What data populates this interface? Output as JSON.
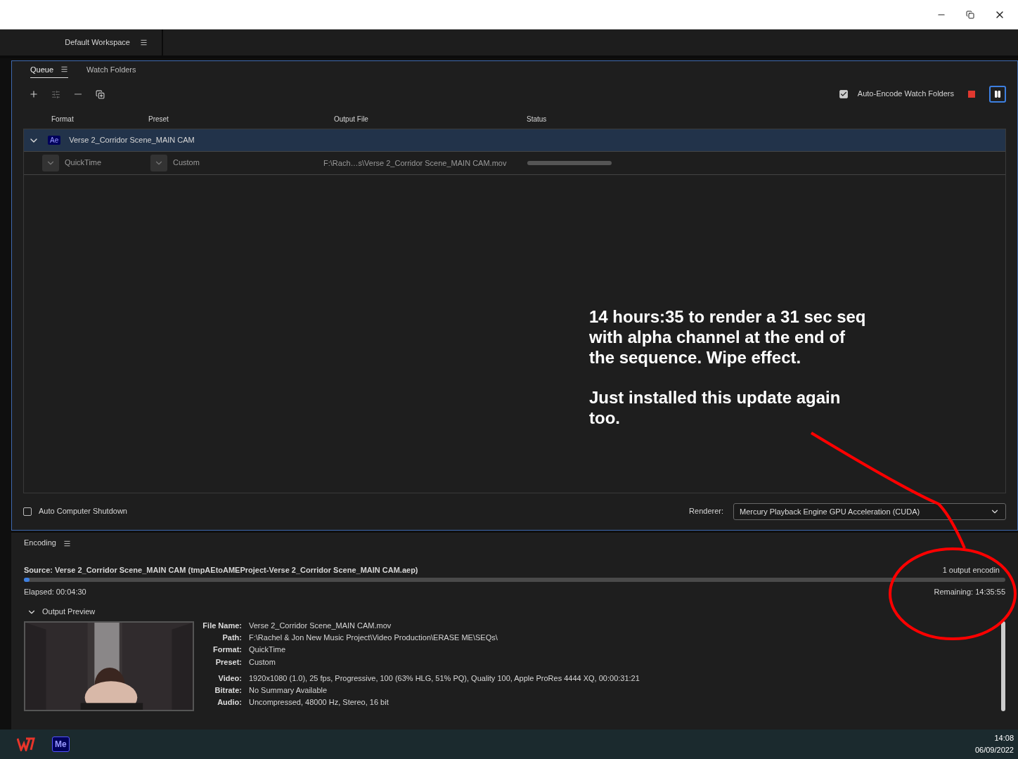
{
  "workspace": {
    "label": "Default Workspace"
  },
  "queue_panel": {
    "tabs": [
      {
        "label": "Queue",
        "selected": true
      },
      {
        "label": "Watch Folders",
        "selected": false
      }
    ],
    "auto_encode": {
      "label": "Auto-Encode Watch Folders",
      "checked": true
    },
    "columns": [
      "Format",
      "Preset",
      "Output File",
      "Status"
    ],
    "source": {
      "badge": "Ae",
      "name": "Verse 2_Corridor Scene_MAIN CAM",
      "expanded": true,
      "selected": true
    },
    "outputs": [
      {
        "format": "QuickTime",
        "preset": "Custom",
        "output_file": "F:\\Rach…s\\Verse 2_Corridor Scene_MAIN CAM.mov"
      }
    ],
    "auto_shutdown": {
      "label": "Auto Computer Shutdown",
      "checked": false
    },
    "renderer": {
      "label": "Renderer:",
      "value": "Mercury Playback Engine GPU Acceleration (CUDA)"
    }
  },
  "annotation": {
    "paragraphs": [
      "14 hours:35 to render a 31 sec seq with alpha channel at the end of the sequence. Wipe effect.",
      "Just installed this update again too."
    ]
  },
  "encoding_panel": {
    "title": "Encoding",
    "source": "Source: Verse 2_Corridor Scene_MAIN CAM (tmpAEtoAMEProject-Verse 2_Corridor Scene_MAIN CAM.aep)",
    "output_count": "1 output encodin",
    "level": 0.006,
    "elapsed": "Elapsed: 00:04:30",
    "remaining": "Remaining: 14:35:55",
    "preview": {
      "label": "Output Preview",
      "expanded": true
    },
    "file_details": [
      {
        "label": "File Name:",
        "value": "Verse 2_Corridor Scene_MAIN CAM.mov"
      },
      {
        "label": "Path:",
        "value": "F:\\Rachel & Jon New Music Project\\Video Production\\ERASE ME\\SEQs\\"
      },
      {
        "label": "Format:",
        "value": "QuickTime"
      },
      {
        "label": "Preset:",
        "value": "Custom"
      }
    ],
    "media_details": [
      {
        "label": "Video:",
        "value": "1920x1080 (1.0), 25 fps, Progressive, 100 (63% HLG, 51% PQ), Quality 100, Apple ProRes 4444 XQ, 00:00:31:21"
      },
      {
        "label": "Bitrate:",
        "value": "No Summary Available"
      },
      {
        "label": "Audio:",
        "value": "Uncompressed, 48000 Hz, Stereo, 16 bit"
      }
    ]
  },
  "taskbar": {
    "apps": [
      {
        "kind": "wps"
      },
      {
        "kind": "media-encoder",
        "label": "Me"
      }
    ],
    "time": "14:08",
    "date": "06/09/2022"
  }
}
